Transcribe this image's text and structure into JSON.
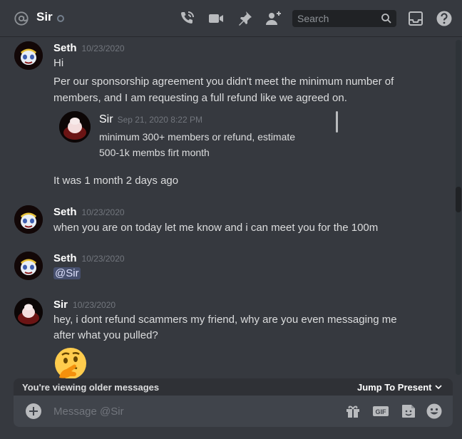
{
  "header": {
    "channel_name": "Sir",
    "search_placeholder": "Search",
    "icons": [
      "at-icon",
      "phone-icon",
      "video-icon",
      "pin-icon",
      "add-friend-icon",
      "search-icon",
      "inbox-icon",
      "help-icon"
    ]
  },
  "messages": [
    {
      "author": "Seth",
      "timestamp": "10/23/2020",
      "lines": [
        "Hi",
        "Per our sponsorship agreement you didn't meet the minimum number of",
        "members, and I am requesting a full refund like we agreed on."
      ],
      "quote": {
        "author": "Sir",
        "timestamp": "Sep 21, 2020 8:22 PM",
        "lines": [
          "minimum 300+ members or refund, estimate",
          "500-1k membs firt month"
        ]
      },
      "after_quote": "It was 1 month 2 days ago"
    },
    {
      "author": "Seth",
      "timestamp": "10/23/2020",
      "lines": [
        "when you are on today let me know and i can meet you for the 100m"
      ]
    },
    {
      "author": "Seth",
      "timestamp": "10/23/2020",
      "mention": "@Sir"
    },
    {
      "author": "Sir",
      "timestamp": "10/23/2020",
      "lines": [
        "hey, i dont refund scammers my friend, why are you even messaging me",
        "after what you pulled?"
      ],
      "emoji": "thinking-face"
    }
  ],
  "older_bar": {
    "text": "You're viewing older messages",
    "jump_label": "Jump To Present"
  },
  "composer": {
    "placeholder": "Message @Sir",
    "icons": [
      "add-icon",
      "gift-icon",
      "gif-icon",
      "sticker-icon",
      "emoji-icon"
    ]
  },
  "colors": {
    "background": "#36393f",
    "input_background": "#40444b",
    "mention_background": "#4e5a8a",
    "text": "#dcddde",
    "timestamp": "#72767d"
  }
}
